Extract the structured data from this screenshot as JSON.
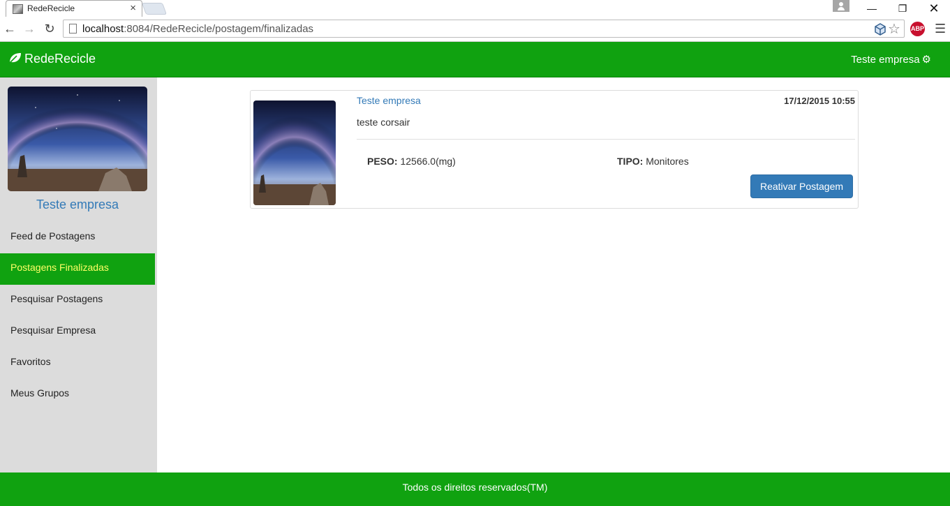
{
  "browser": {
    "tab_title": "RedeRecicle",
    "url_host": "localhost",
    "url_path": ":8084/RedeRecicle/postagem/finalizadas",
    "abp_label": "ABP"
  },
  "navbar": {
    "brand": "RedeRecicle",
    "user_label": "Teste empresa",
    "color": "#10a210"
  },
  "sidebar": {
    "profile_name": "Teste empresa",
    "items": [
      {
        "label": "Feed de Postagens",
        "active": false
      },
      {
        "label": "Postagens Finalizadas",
        "active": true
      },
      {
        "label": "Pesquisar Postagens",
        "active": false
      },
      {
        "label": "Pesquisar Empresa",
        "active": false
      },
      {
        "label": "Favoritos",
        "active": false
      },
      {
        "label": "Meus Grupos",
        "active": false
      }
    ]
  },
  "post": {
    "author": "Teste empresa",
    "date": "17/12/2015 10:55",
    "text": "teste corsair",
    "peso_label": "PESO:",
    "peso_value": "12566.0(mg)",
    "tipo_label": "TIPO:",
    "tipo_value": "Monitores",
    "button_label": "Reativar Postagem"
  },
  "footer": {
    "text": "Todos os direitos reservados(TM)"
  }
}
